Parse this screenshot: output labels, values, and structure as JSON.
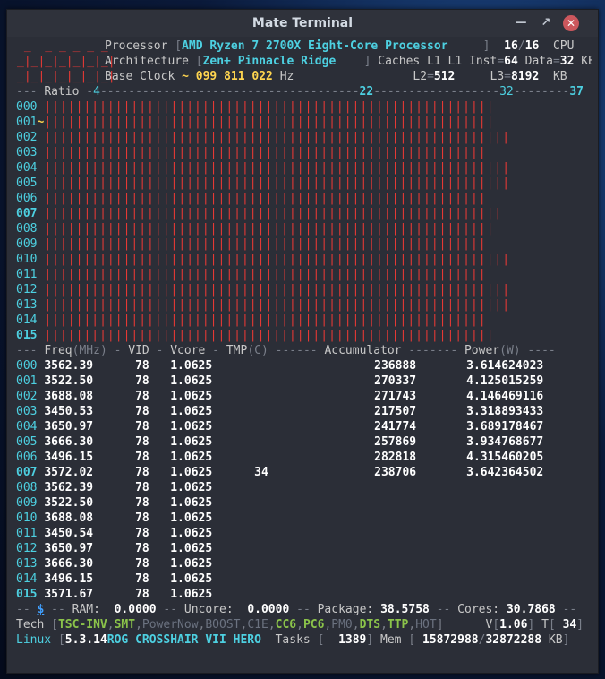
{
  "window": {
    "title": "Mate Terminal"
  },
  "header": {
    "processor_label": "Processor",
    "processor": "AMD Ryzen 7 2700X Eight-Core Processor",
    "threads": "16",
    "threads_total": "16",
    "cpu_label": "CPU",
    "arch_label": "Architecture",
    "arch": "Zen+ Pinnacle Ridge",
    "caches_label": "Caches",
    "l1_inst_label": "L1 Inst",
    "l1_inst": "64",
    "l1_data_label": "Data",
    "l1_data": "32",
    "kb": "KB",
    "base_clock_label": "Base Clock",
    "base_clock": "~ 099 811 022",
    "hz": "Hz",
    "l2_label": "L2",
    "l2": "512",
    "l3_label": "L3",
    "l3": "8192"
  },
  "ratio": {
    "label": "Ratio",
    "min": "4",
    "mid": "22",
    "max1": "32",
    "max2": "37"
  },
  "cores_bars": [
    {
      "id": "000",
      "bars": 114,
      "bold": false
    },
    {
      "id": "001",
      "bars": 114,
      "bold": false,
      "marker": "~"
    },
    {
      "id": "002",
      "bars": 118,
      "bold": false
    },
    {
      "id": "003",
      "bars": 112,
      "bold": false
    },
    {
      "id": "004",
      "bars": 118,
      "bold": false
    },
    {
      "id": "005",
      "bars": 118,
      "bold": false
    },
    {
      "id": "006",
      "bars": 112,
      "bold": false
    },
    {
      "id": "007",
      "bars": 115,
      "bold": true
    },
    {
      "id": "008",
      "bars": 114,
      "bold": false
    },
    {
      "id": "009",
      "bars": 112,
      "bold": false
    },
    {
      "id": "010",
      "bars": 118,
      "bold": false
    },
    {
      "id": "011",
      "bars": 112,
      "bold": false
    },
    {
      "id": "012",
      "bars": 118,
      "bold": false
    },
    {
      "id": "013",
      "bars": 118,
      "bold": false
    },
    {
      "id": "014",
      "bars": 112,
      "bold": false
    },
    {
      "id": "015",
      "bars": 114,
      "bold": true
    }
  ],
  "columns": {
    "freq": "Freq",
    "mhz": "MHz",
    "vid": "VID",
    "vcore": "Vcore",
    "tmp": "TMP",
    "c": "C",
    "accumulator": "Accumulator",
    "power": "Power",
    "w": "W"
  },
  "rows": [
    {
      "id": "000",
      "freq": "3562.39",
      "vid": "78",
      "vcore": "1.0625",
      "tmp": "",
      "acc": "236888",
      "power": "3.614624023"
    },
    {
      "id": "001",
      "freq": "3522.50",
      "vid": "78",
      "vcore": "1.0625",
      "tmp": "",
      "acc": "270337",
      "power": "4.125015259"
    },
    {
      "id": "002",
      "freq": "3688.08",
      "vid": "78",
      "vcore": "1.0625",
      "tmp": "",
      "acc": "271743",
      "power": "4.146469116"
    },
    {
      "id": "003",
      "freq": "3450.53",
      "vid": "78",
      "vcore": "1.0625",
      "tmp": "",
      "acc": "217507",
      "power": "3.318893433"
    },
    {
      "id": "004",
      "freq": "3650.97",
      "vid": "78",
      "vcore": "1.0625",
      "tmp": "",
      "acc": "241774",
      "power": "3.689178467"
    },
    {
      "id": "005",
      "freq": "3666.30",
      "vid": "78",
      "vcore": "1.0625",
      "tmp": "",
      "acc": "257869",
      "power": "3.934768677"
    },
    {
      "id": "006",
      "freq": "3496.15",
      "vid": "78",
      "vcore": "1.0625",
      "tmp": "",
      "acc": "282818",
      "power": "4.315460205"
    },
    {
      "id": "007",
      "freq": "3572.02",
      "vid": "78",
      "vcore": "1.0625",
      "tmp": "34",
      "acc": "238706",
      "power": "3.642364502",
      "bold": true
    },
    {
      "id": "008",
      "freq": "3562.39",
      "vid": "78",
      "vcore": "1.0625",
      "tmp": "",
      "acc": "",
      "power": ""
    },
    {
      "id": "009",
      "freq": "3522.50",
      "vid": "78",
      "vcore": "1.0625",
      "tmp": "",
      "acc": "",
      "power": ""
    },
    {
      "id": "010",
      "freq": "3688.08",
      "vid": "78",
      "vcore": "1.0625",
      "tmp": "",
      "acc": "",
      "power": ""
    },
    {
      "id": "011",
      "freq": "3450.54",
      "vid": "78",
      "vcore": "1.0625",
      "tmp": "",
      "acc": "",
      "power": ""
    },
    {
      "id": "012",
      "freq": "3650.97",
      "vid": "78",
      "vcore": "1.0625",
      "tmp": "",
      "acc": "",
      "power": ""
    },
    {
      "id": "013",
      "freq": "3666.30",
      "vid": "78",
      "vcore": "1.0625",
      "tmp": "",
      "acc": "",
      "power": ""
    },
    {
      "id": "014",
      "freq": "3496.15",
      "vid": "78",
      "vcore": "1.0625",
      "tmp": "",
      "acc": "",
      "power": ""
    },
    {
      "id": "015",
      "freq": "3571.67",
      "vid": "78",
      "vcore": "1.0625",
      "tmp": "",
      "acc": "",
      "power": "",
      "bold": true
    }
  ],
  "summary": {
    "dollar": "$",
    "ram_label": "RAM:",
    "ram": "0.0000",
    "uncore_label": "Uncore:",
    "uncore": "0.0000",
    "package_label": "Package:",
    "package": "38.5758",
    "cores_label": "Cores:",
    "cores": "30.7868"
  },
  "tech": {
    "label": "Tech",
    "flags": [
      {
        "name": "TSC-INV",
        "on": true
      },
      {
        "name": "SMT",
        "on": true
      },
      {
        "name": "PowerNow",
        "on": false
      },
      {
        "name": "BOOST",
        "on": false
      },
      {
        "name": "C1E",
        "on": false
      },
      {
        "name": "CC6",
        "on": true
      },
      {
        "name": "PC6",
        "on": true
      },
      {
        "name": "PM0",
        "on": false
      },
      {
        "name": "DTS",
        "on": true
      },
      {
        "name": "TTP",
        "on": true
      },
      {
        "name": "HOT",
        "on": false
      }
    ],
    "v_label": "V",
    "v": "1.06",
    "t_label": "T",
    "t": "34"
  },
  "footer": {
    "os": "Linux",
    "kernel": "5.3.14",
    "board": "ROG CROSSHAIR VII HERO",
    "tasks_label": "Tasks",
    "tasks": "1389",
    "mem_label": "Mem",
    "mem_used": "15872988",
    "mem_total": "32872288",
    "kb": "KB"
  },
  "colors": {
    "background": "#2b2e37",
    "bars": "#e53935",
    "accent": "#4dd0e1",
    "value": "#ffd54f",
    "flag_on": "#8bc34a"
  }
}
